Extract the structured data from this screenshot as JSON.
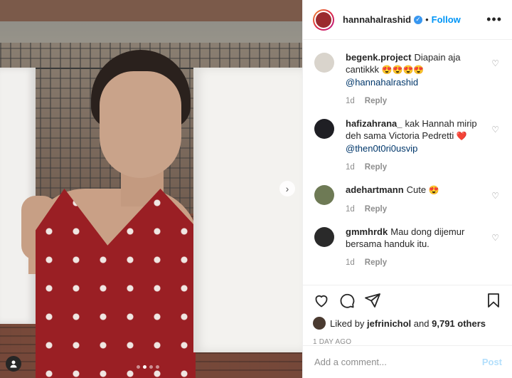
{
  "header": {
    "username": "hannahalrashid",
    "separator": "•",
    "follow_label": "Follow",
    "more_label": "•••"
  },
  "comments": [
    {
      "user": "begenk.project",
      "text": "Diapain aja cantikkk",
      "emoji": "😍😍😍😍",
      "mention": "@hannahalrashid",
      "time": "1d",
      "reply": "Reply",
      "avatar_color": "#d9d4cc"
    },
    {
      "user": "hafizahrana_",
      "text": "kak Hannah mirip deh sama Victoria Pedretti",
      "emoji": "❤️",
      "mention": "@then0t0ri0usvip",
      "time": "1d",
      "reply": "Reply",
      "avatar_color": "#1f1f24"
    },
    {
      "user": "adehartmann",
      "text": "Cute",
      "emoji": "😍",
      "mention": "",
      "time": "1d",
      "reply": "Reply",
      "avatar_color": "#6e7a55"
    },
    {
      "user": "gmmhrdk",
      "text": "Mau dong dijemur bersama handuk itu.",
      "emoji": "",
      "mention": "",
      "time": "1d",
      "reply": "Reply",
      "avatar_color": "#2a2a2a"
    }
  ],
  "likes": {
    "prefix": "Liked by",
    "user": "jefrinichol",
    "and": "and",
    "count": "9,791 others"
  },
  "time_ago": "1 DAY AGO",
  "add_comment": {
    "placeholder": "Add a comment...",
    "post_label": "Post"
  },
  "photo": {
    "next_arrow": "›",
    "dots": 4,
    "active_dot": 1
  }
}
